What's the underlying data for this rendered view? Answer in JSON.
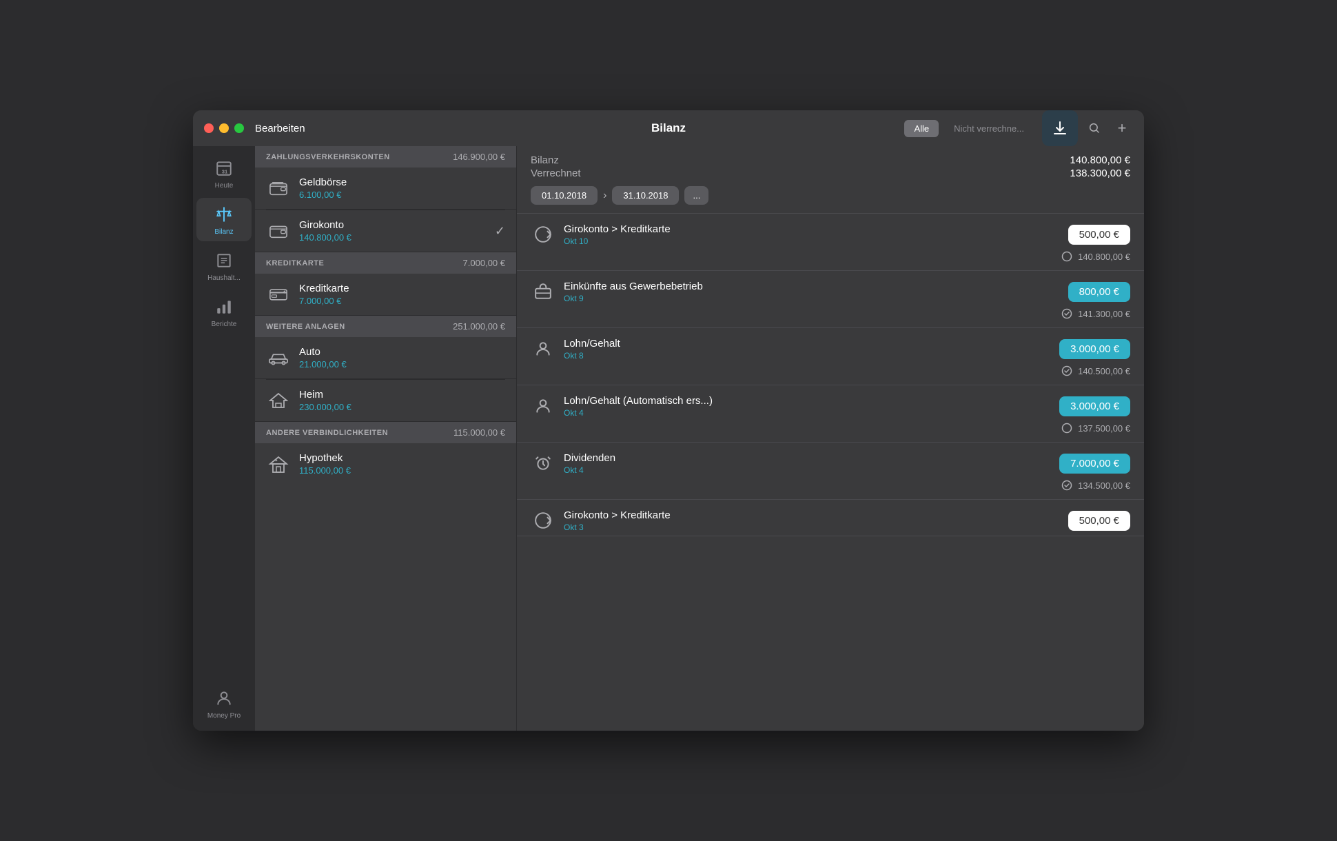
{
  "window": {
    "title": "Bilanz"
  },
  "titlebar": {
    "edit_label": "Bearbeiten",
    "title": "Bilanz",
    "btn_alle": "Alle",
    "btn_nicht": "Nicht verrechne...",
    "search_icon": "🔍",
    "add_icon": "+"
  },
  "sidebar": {
    "items": [
      {
        "id": "heute",
        "label": "Heute",
        "icon": "📅"
      },
      {
        "id": "bilanz",
        "label": "Bilanz",
        "icon": "⚖️",
        "active": true
      },
      {
        "id": "haushalt",
        "label": "Haushalt...",
        "icon": "📋"
      },
      {
        "id": "berichte",
        "label": "Berichte",
        "icon": "📊"
      }
    ],
    "bottom_item": {
      "id": "money-pro",
      "label": "Money Pro",
      "icon": "👤"
    }
  },
  "left_panel": {
    "sections": [
      {
        "id": "zahlungsverkehr",
        "label": "ZAHLUNGSVERKEHRSKONTEN",
        "amount": "146.900,00 €",
        "accounts": [
          {
            "id": "geldboerse",
            "name": "Geldbörse",
            "amount": "6.100,00 €",
            "icon": "wallet"
          },
          {
            "id": "girokonto",
            "name": "Girokonto",
            "amount": "140.800,00 €",
            "icon": "wallet2",
            "checked": true
          }
        ]
      },
      {
        "id": "kreditkarte",
        "label": "KREDITKARTE",
        "amount": "7.000,00 €",
        "accounts": [
          {
            "id": "kreditkarte",
            "name": "Kreditkarte",
            "amount": "7.000,00 €",
            "icon": "credit"
          }
        ]
      },
      {
        "id": "weitere",
        "label": "WEITERE ANLAGEN",
        "amount": "251.000,00 €",
        "accounts": [
          {
            "id": "auto",
            "name": "Auto",
            "amount": "21.000,00 €",
            "icon": "car"
          },
          {
            "id": "heim",
            "name": "Heim",
            "amount": "230.000,00 €",
            "icon": "home"
          }
        ]
      },
      {
        "id": "verbindlichkeiten",
        "label": "ANDERE VERBINDLICHKEITEN",
        "amount": "115.000,00 €",
        "accounts": [
          {
            "id": "hypothek",
            "name": "Hypothek",
            "amount": "115.000,00 €",
            "icon": "mortgage"
          }
        ]
      }
    ]
  },
  "right_panel": {
    "bilanz_label": "Bilanz",
    "bilanz_value": "140.800,00 €",
    "verrechnet_label": "Verrechnet",
    "verrechnet_value": "138.300,00 €",
    "date_from": "01.10.2018",
    "date_to": "31.10.2018",
    "date_more": "...",
    "transactions": [
      {
        "id": "t1",
        "name": "Girokonto > Kreditkarte",
        "date": "Okt 10",
        "amount": "500,00 €",
        "amount_style": "white",
        "balance": "140.800,00 €",
        "icon": "transfer",
        "status_icon": "circle"
      },
      {
        "id": "t2",
        "name": "Einkünfte aus Gewerbebetrieb",
        "date": "Okt 9",
        "amount": "800,00 €",
        "amount_style": "cyan",
        "balance": "141.300,00 €",
        "icon": "briefcase",
        "status_icon": "check-circle"
      },
      {
        "id": "t3",
        "name": "Lohn/Gehalt",
        "date": "Okt 8",
        "amount": "3.000,00 €",
        "amount_style": "cyan",
        "balance": "140.500,00 €",
        "icon": "person",
        "status_icon": "check-circle"
      },
      {
        "id": "t4",
        "name": "Lohn/Gehalt (Automatisch ers...)",
        "date": "Okt 4",
        "amount": "3.000,00 €",
        "amount_style": "cyan",
        "balance": "137.500,00 €",
        "icon": "person",
        "status_icon": "circle"
      },
      {
        "id": "t5",
        "name": "Dividenden",
        "date": "Okt 4",
        "amount": "7.000,00 €",
        "amount_style": "cyan",
        "balance": "134.500,00 €",
        "icon": "alarm",
        "status_icon": "check-circle"
      },
      {
        "id": "t6",
        "name": "Girokonto > Kreditkarte",
        "date": "Okt 3",
        "amount": "500,00 €",
        "amount_style": "white",
        "balance": "",
        "icon": "transfer",
        "status_icon": ""
      }
    ]
  },
  "colors": {
    "cyan": "#30b0c7",
    "accent": "#5ac8fa",
    "bg_dark": "#2c2c2e",
    "bg_mid": "#3a3a3c",
    "bg_light": "#4a4a4e"
  }
}
